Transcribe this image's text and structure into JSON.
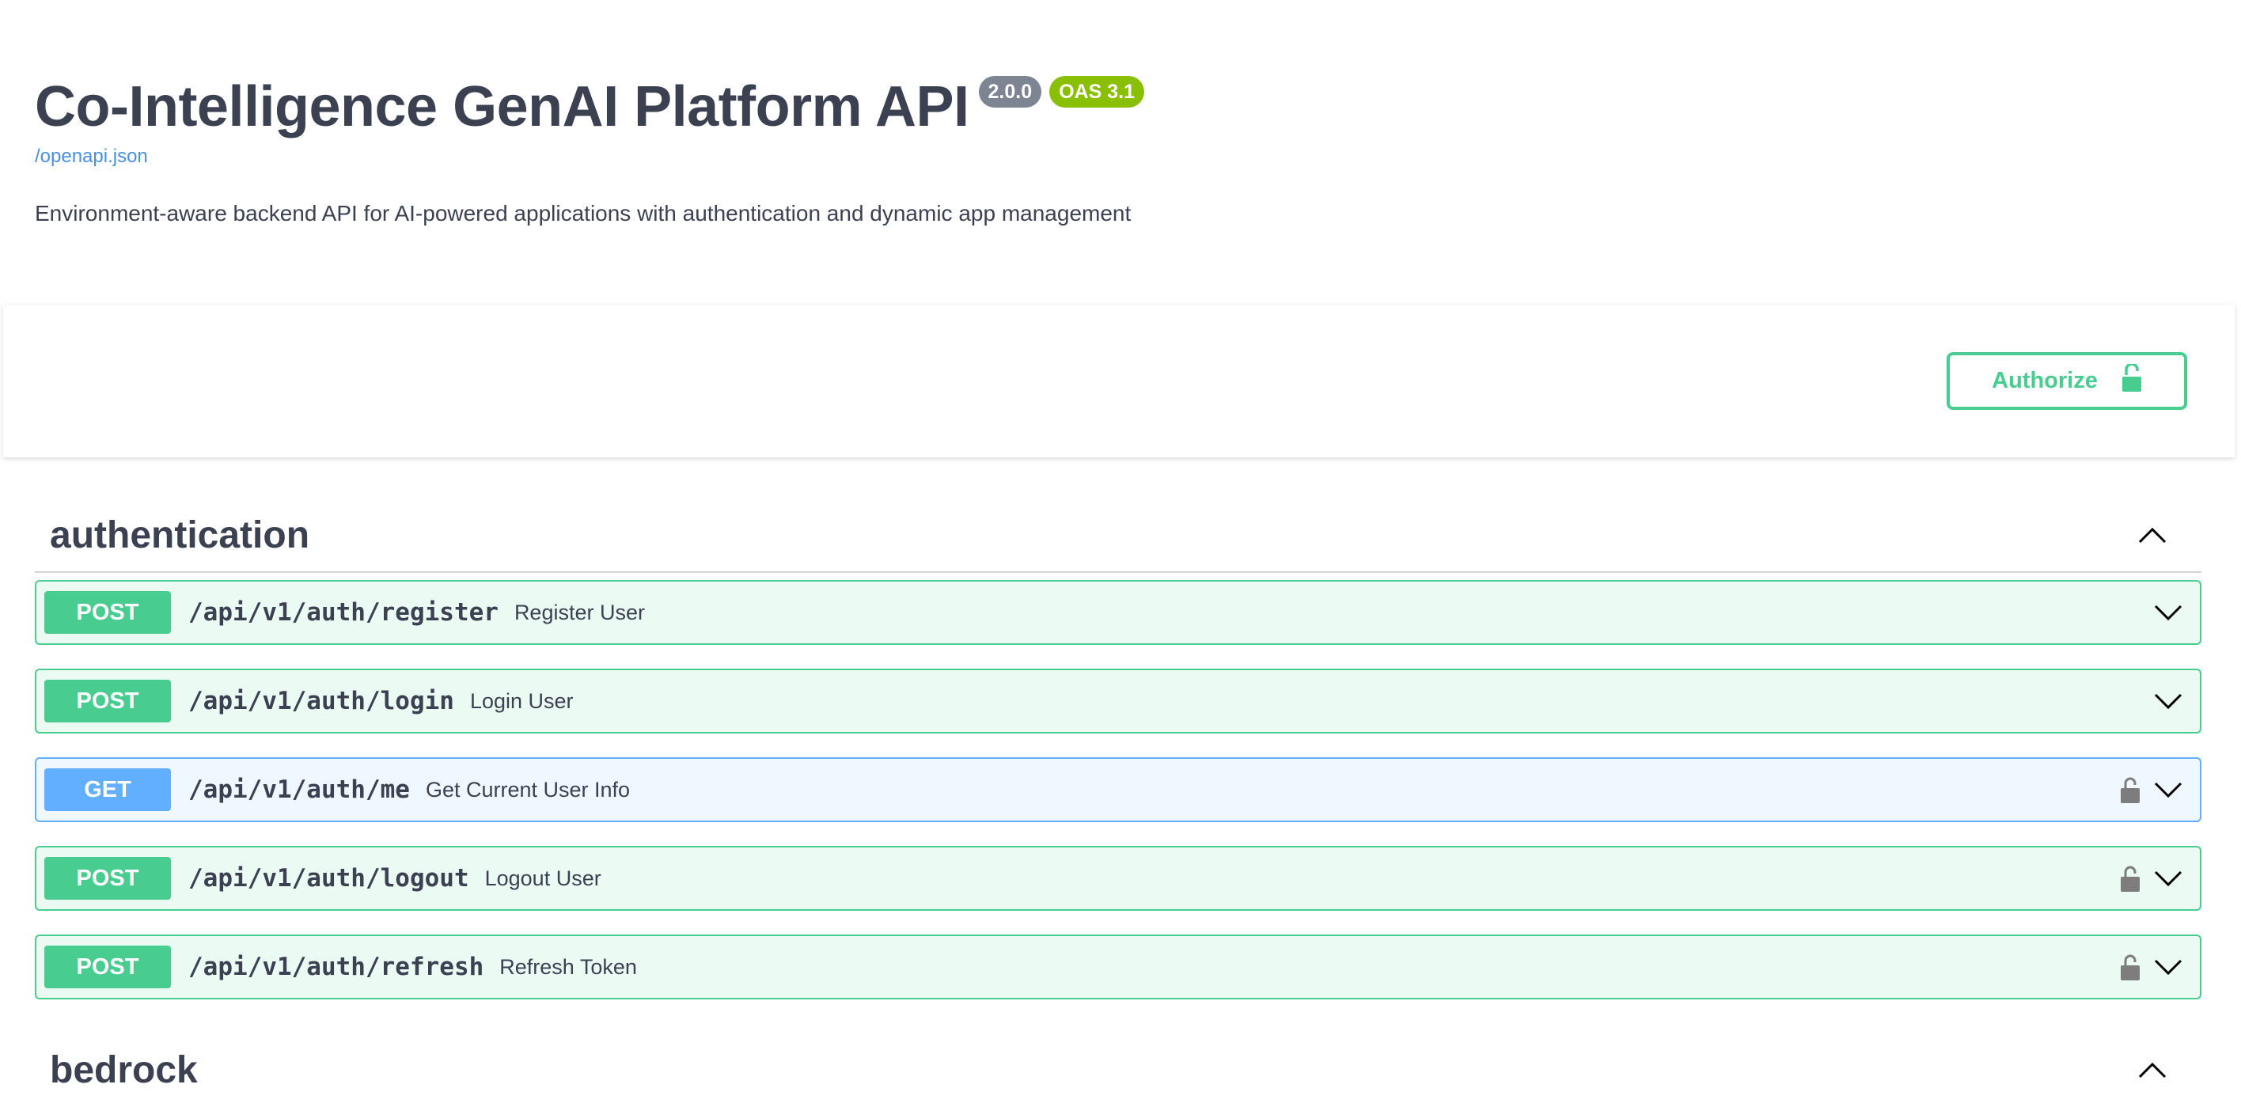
{
  "info": {
    "title": "Co-Intelligence GenAI Platform API",
    "version_badge": "2.0.0",
    "oas_badge": "OAS 3.1",
    "spec_link": "/openapi.json",
    "description": "Environment-aware backend API for AI-powered applications with authentication and dynamic app management"
  },
  "scheme": {
    "authorize_label": "Authorize"
  },
  "tags": [
    {
      "name": "authentication",
      "operations": [
        {
          "method": "POST",
          "path": "/api/v1/auth/register",
          "summary": "Register User"
        },
        {
          "method": "POST",
          "path": "/api/v1/auth/login",
          "summary": "Login User"
        },
        {
          "method": "GET",
          "path": "/api/v1/auth/me",
          "summary": "Get Current User Info"
        },
        {
          "method": "POST",
          "path": "/api/v1/auth/logout",
          "summary": "Logout User"
        },
        {
          "method": "POST",
          "path": "/api/v1/auth/refresh",
          "summary": "Refresh Token"
        }
      ]
    },
    {
      "name": "bedrock",
      "operations": []
    }
  ],
  "icons": {
    "unlock": "unlock-icon",
    "lock": "lock-icon",
    "chevron_up": "chevron-up-icon",
    "chevron_down": "chevron-down-icon"
  },
  "colors": {
    "post": "#49cc90",
    "get": "#61affe",
    "text": "#3b4151",
    "link": "#4990e2",
    "version_badge": "#7d8492",
    "oas_badge": "#89bf04"
  }
}
